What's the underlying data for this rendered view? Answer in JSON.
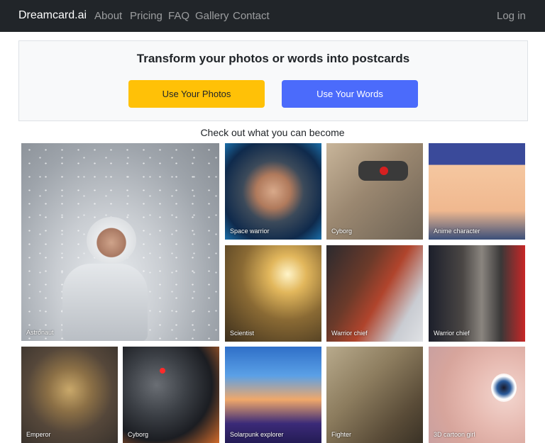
{
  "nav": {
    "brand": "Dreamcard.ai",
    "links": [
      "About",
      "Pricing",
      "FAQ",
      "Gallery",
      "Contact"
    ],
    "login": "Log in"
  },
  "hero": {
    "title": "Transform your photos or words into postcards",
    "photos_button": "Use Your Photos",
    "words_button": "Use Your Words"
  },
  "gallery": {
    "heading": "Check out what you can become",
    "items": [
      "Astronaut",
      "Space warrior",
      "Cyborg",
      "Anime character",
      "Scientist",
      "Warrior chief",
      "Warrior chief",
      "Emperor",
      "Cyborg",
      "Solarpunk explorer",
      "Fighter",
      "3D cartoon girl"
    ]
  },
  "colors": {
    "navbar": "#212529",
    "photos_button": "#ffc107",
    "words_button": "#4b6bfb"
  }
}
